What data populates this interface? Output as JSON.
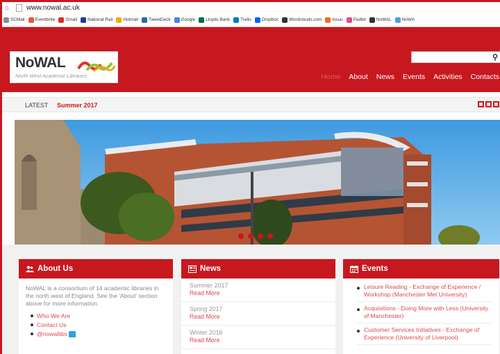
{
  "browser": {
    "url": "www.nowal.ac.uk",
    "bookmarks": [
      {
        "label": "SCMail",
        "color": "#8a8a8a"
      },
      {
        "label": "Eventbrite",
        "color": "#f05537"
      },
      {
        "label": "Gmail",
        "color": "#d93025"
      },
      {
        "label": "National Rail",
        "color": "#1b3f8f"
      },
      {
        "label": "Hotmail",
        "color": "#f2a900"
      },
      {
        "label": "TweetDeck",
        "color": "#1d6fb8"
      },
      {
        "label": "Google",
        "color": "#4285f4"
      },
      {
        "label": "Lloyds Bank",
        "color": "#006a4d"
      },
      {
        "label": "Trello",
        "color": "#0079bf"
      },
      {
        "label": "Dropbox",
        "color": "#0061fe"
      },
      {
        "label": "Wordclouds.com",
        "color": "#333333"
      },
      {
        "label": "Issuu",
        "color": "#f36d21"
      },
      {
        "label": "Padlet",
        "color": "#e64a8a"
      },
      {
        "label": "NoWAL",
        "color": "#333333"
      },
      {
        "label": "NoWA",
        "color": "#4aa3df"
      }
    ]
  },
  "header": {
    "logo_name": "NoWAL",
    "logo_tagline": "North West Academic Libraries",
    "search_placeholder": "",
    "nav": [
      {
        "label": "Home",
        "active": true
      },
      {
        "label": "About",
        "active": false
      },
      {
        "label": "News",
        "active": false
      },
      {
        "label": "Events",
        "active": false
      },
      {
        "label": "Activities",
        "active": false
      },
      {
        "label": "Contacts",
        "active": false
      }
    ]
  },
  "latest": {
    "label": "LATEST",
    "item": "Summer 2017"
  },
  "about": {
    "title": "About Us",
    "text": "NoWAL is a consortium of 14 academic libraries in the north west of England. See the 'About' section above for more information.",
    "links": [
      "Who We Are",
      "Contact Us",
      "@nowallibs"
    ]
  },
  "news": {
    "title": "News",
    "entries": [
      {
        "title": "Summer 2017",
        "link": "Read More"
      },
      {
        "title": "Spring 2017",
        "link": "Read More"
      },
      {
        "title": "Winter 2016",
        "link": "Read More"
      }
    ]
  },
  "events": {
    "title": "Events",
    "items": [
      "Leisure Reading - Exchange of Experience / Workshop (Manchester Met University)",
      "Acquisitions - Doing More with Less (University of Manchester)",
      "Customer Services Initiatives - Exchange of Experience (University of Liverpool)"
    ]
  },
  "colors": {
    "brand_red": "#c7181f",
    "link_red": "#e0484f"
  }
}
